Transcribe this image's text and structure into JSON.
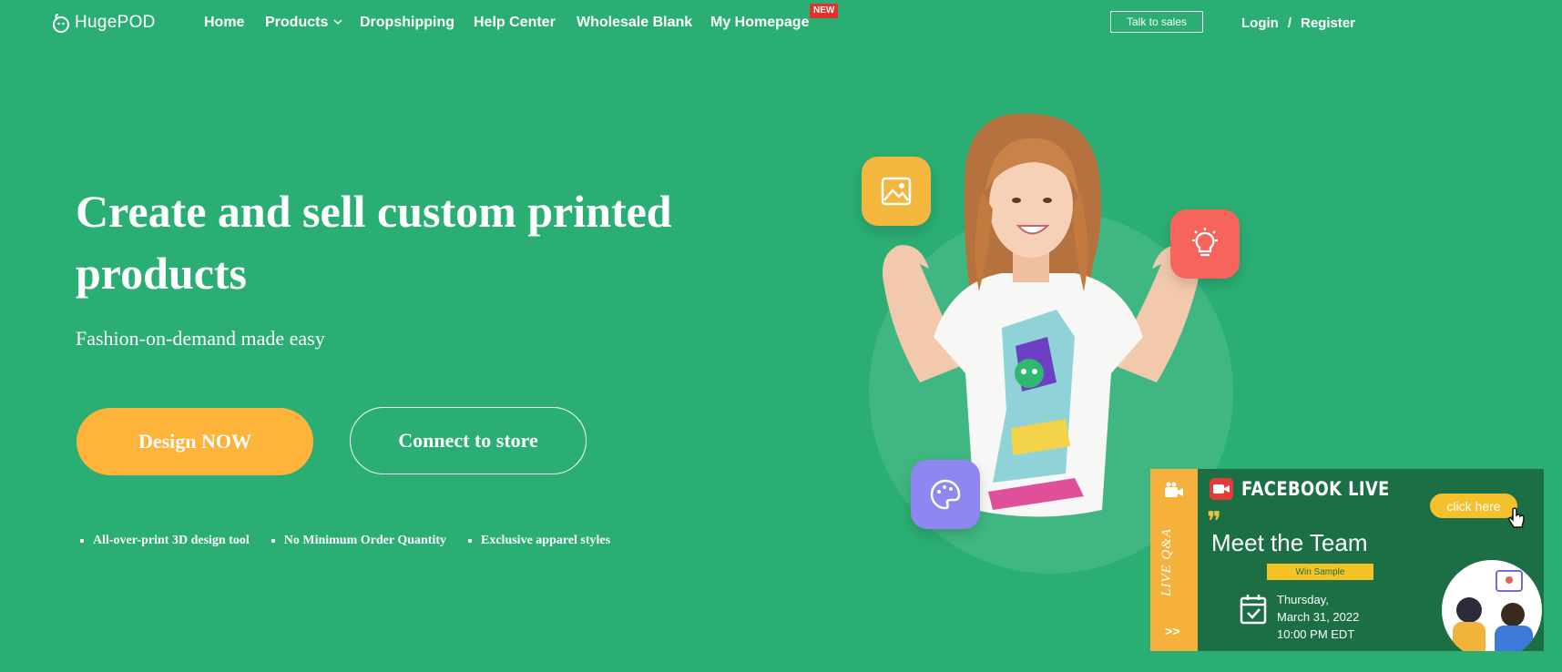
{
  "brand": {
    "name": "HugePOD"
  },
  "nav": {
    "items": [
      {
        "label": "Home"
      },
      {
        "label": "Products"
      },
      {
        "label": "Dropshipping"
      },
      {
        "label": "Help Center"
      },
      {
        "label": "Wholesale Blank"
      },
      {
        "label": "My Homepage"
      }
    ],
    "new_badge": "NEW",
    "talk_to_sales": "Talk to sales",
    "login": "Login",
    "separator": "/",
    "register": "Register"
  },
  "hero": {
    "title": "Create and sell custom printed products",
    "subtitle": "Fashion-on-demand made easy",
    "design_button": "Design NOW",
    "connect_button": "Connect to store",
    "features": [
      "All-over-print 3D design tool",
      "No Minimum Order Quantity",
      "Exclusive apparel styles"
    ]
  },
  "live_banner": {
    "side_label": "LIVE Q&A",
    "arrows": ">>",
    "title": "FACEBOOK LIVE",
    "cta": "click here",
    "headline": "Meet the Team",
    "tag": "Win Sample",
    "date_lines": [
      "Thursday,",
      "March 31, 2022",
      "10:00 PM EDT"
    ]
  },
  "colors": {
    "background": "#2bae74",
    "accent_orange": "#feb33b",
    "badge_red": "#e4312b",
    "banner_green": "#1c6f45",
    "banner_yellow": "#f6b03c"
  }
}
